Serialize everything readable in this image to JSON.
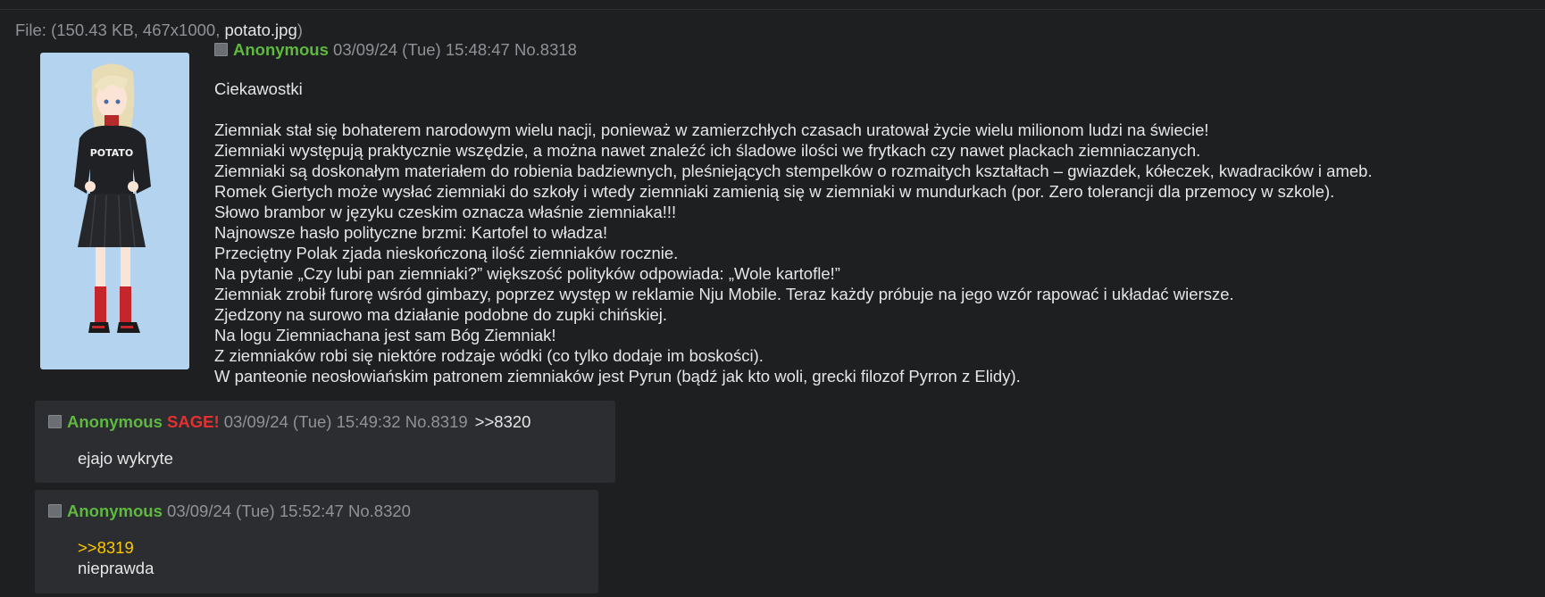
{
  "file": {
    "prefix": "File: (150.43 KB, 467x1000, ",
    "name": "potato.jpg",
    "suffix": ")"
  },
  "thumbnail": {
    "shirt_text": "POTATO"
  },
  "op": {
    "name": "Anonymous",
    "meta": "03/09/24 (Tue) 15:48:47 No.8318",
    "subject": "Ciekawostki",
    "lines": [
      "Ziemniak stał się bohaterem narodowym wielu nacji, ponieważ w zamierzchłych czasach uratował życie wielu milionom ludzi na świecie!",
      "Ziemniaki występują praktycznie wszędzie, a można nawet znaleźć ich śladowe ilości we frytkach czy nawet plackach ziemniaczanych.",
      "Ziemniaki są doskonałym materiałem do robienia badziewnych, pleśniejących stempelków o rozmaitych kształtach – gwiazdek, kółeczek, kwadracików i ameb.",
      "Romek Giertych może wysłać ziemniaki do szkoły i wtedy ziemniaki zamienią się w ziemniaki w mundurkach (por. Zero tolerancji dla przemocy w szkole).",
      "Słowo brambor w języku czeskim oznacza właśnie ziemniaka!!!",
      "Najnowsze hasło polityczne brzmi: Kartofel to władza!",
      "Przeciętny Polak zjada nieskończoną ilość ziemniaków rocznie.",
      "Na pytanie „Czy lubi pan ziemniaki?” większość polityków odpowiada: „Wole kartofle!”",
      "Ziemniak zrobił furorę wśród gimbazy, poprzez występ w reklamie Nju Mobile. Teraz każdy próbuje na jego wzór rapować i układać wiersze.",
      "Zjedzony na surowo ma działanie podobne do zupki chińskiej.",
      "Na logu Ziemniachana jest sam Bóg Ziemniak!",
      "Z ziemniaków robi się niektóre rodzaje wódki (co tylko dodaje im boskości).",
      "W panteonie neosłowiańskim patronem ziemniaków jest Pyrun (bądź jak kto woli, grecki filozof Pyrron z Elidy)."
    ]
  },
  "replies": [
    {
      "name": "Anonymous",
      "sage": "SAGE!",
      "meta": "03/09/24 (Tue) 15:49:32 No.8319",
      "backlink": ">>8320",
      "text": "ejajo wykryte"
    },
    {
      "name": "Anonymous",
      "meta": "03/09/24 (Tue) 15:52:47 No.8320",
      "quote": ">>8319",
      "text": "nieprawda"
    }
  ],
  "colors": {
    "background": "#1d1f21",
    "reply_bg": "#2b2d31",
    "name": "#5fb840",
    "sage": "#e53030",
    "quote": "#ffc800",
    "meta": "#8f9296"
  }
}
